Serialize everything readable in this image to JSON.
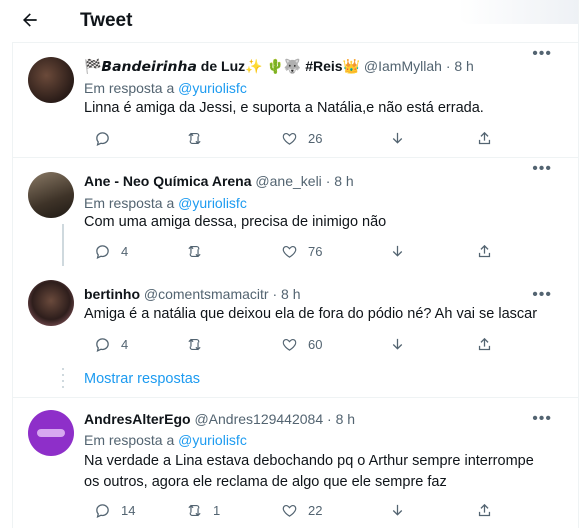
{
  "header": {
    "title": "Tweet"
  },
  "reply_prefix": "Em resposta a",
  "show_more": "Mostrar respostas",
  "tweets": [
    {
      "name": "🏁𝘽𝙖𝙣𝙙𝙚𝙞𝙧𝙞𝙣𝙝𝙖 de Luz✨ 🌵🐺 #Reis👑",
      "handle": "@IamMyllah",
      "time": "· 8 h",
      "reply_to": "@yuriolisfc",
      "text": "Linna é amiga da Jessi,  e suporta a Natália,e não está errada.",
      "replies": "",
      "retweets": "",
      "likes": "26"
    },
    {
      "name": "Ane - Neo Química Arena",
      "handle": "@ane_keli",
      "time": "· 8 h",
      "reply_to": "@yuriolisfc",
      "text": "Com uma amiga dessa, precisa de inimigo não",
      "replies": "4",
      "retweets": "",
      "likes": "76"
    },
    {
      "name": "bertinho",
      "handle": "@comentsmamacitr",
      "time": "· 8 h",
      "reply_to": "",
      "text": "Amiga é a natália que deixou ela de fora do pódio né? Ah vai se lascar",
      "replies": "4",
      "retweets": "",
      "likes": "60"
    },
    {
      "name": "AndresAlterEgo",
      "handle": "@Andres129442084",
      "time": "· 8 h",
      "reply_to": "@yuriolisfc",
      "text": "Na verdade a Lina estava debochando pq o Arthur sempre interrompe os outros, agora ele reclama de algo que ele sempre faz",
      "replies": "14",
      "retweets": "1",
      "likes": "22"
    }
  ],
  "icons": {
    "back": "arrow-left-icon",
    "more": "more-horizontal-icon",
    "reply": "reply-icon",
    "retweet": "retweet-icon",
    "like": "heart-icon",
    "pochette": "down-arrow-icon",
    "share": "share-icon"
  },
  "colors": {
    "accent": "#1d9bf0",
    "muted": "#536471",
    "text": "#0f1419"
  }
}
